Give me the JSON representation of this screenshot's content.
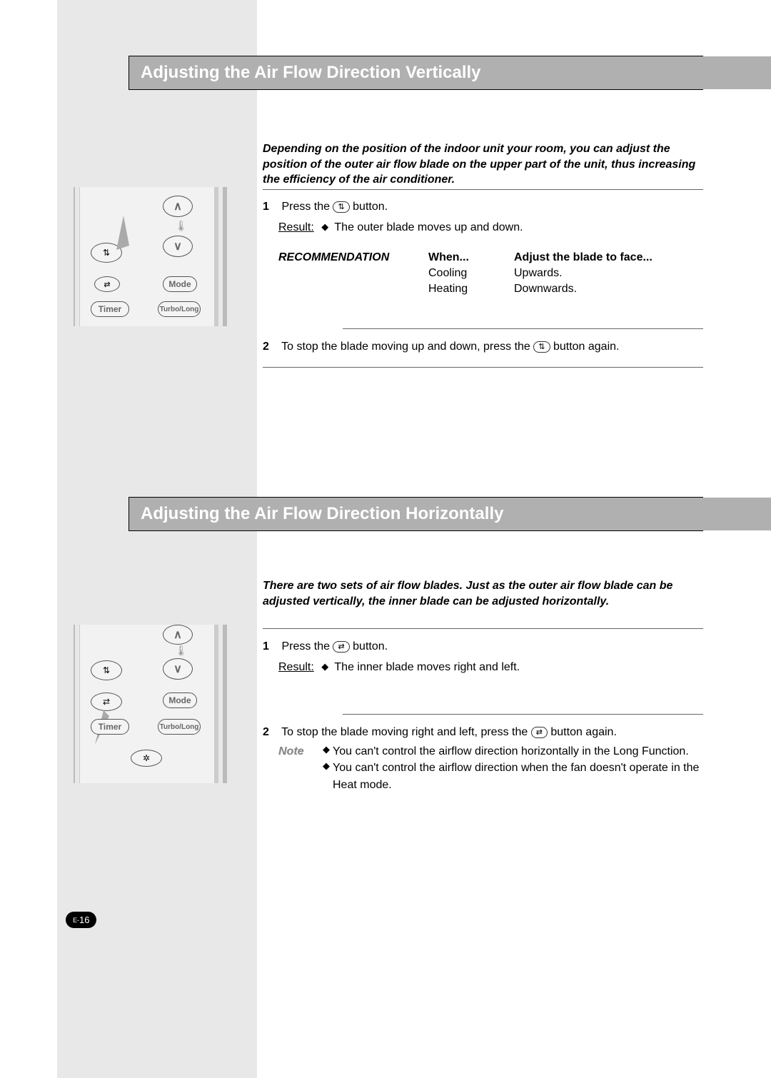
{
  "section1": {
    "title": "Adjusting the Air Flow Direction Vertically",
    "intro": "Depending on the position of the indoor unit your room, you can adjust the position of the outer air flow blade on the upper part of the unit, thus increasing the efficiency of the air conditioner.",
    "step1": {
      "num": "1",
      "press_before": "Press the ",
      "press_after": " button.",
      "result_label": "Result:",
      "result_text": "The outer blade moves up and down."
    },
    "recommendation": {
      "label": "RECOMMENDATION",
      "head_when": "When...",
      "head_adjust": "Adjust the blade to face...",
      "rows": [
        {
          "when": "Cooling",
          "adjust": "Upwards."
        },
        {
          "when": "Heating",
          "adjust": "Downwards."
        }
      ]
    },
    "step2": {
      "num": "2",
      "text_before": "To stop the blade moving up and down, press the ",
      "text_after": " button again."
    }
  },
  "section2": {
    "title": "Adjusting the Air Flow Direction Horizontally",
    "intro": "There are two sets of air flow blades. Just as the outer air flow blade can be adjusted vertically, the inner blade can be adjusted horizontally.",
    "step1": {
      "num": "1",
      "press_before": "Press the ",
      "press_after": " button.",
      "result_label": "Result:",
      "result_text": "The inner blade moves right and left."
    },
    "step2": {
      "num": "2",
      "text_before": "To stop the blade moving right and left, press the ",
      "text_after": " button again."
    },
    "note": {
      "label": "Note",
      "items": [
        "You can't control the airflow direction horizontally in the Long Function.",
        "You can't control the airflow direction when the fan doesn't operate in the Heat mode."
      ]
    }
  },
  "remote": {
    "mode": "Mode",
    "timer": "Timer",
    "turbolong": "Turbo/Long",
    "swing_vert_icon": "swing-vertical-icon",
    "swing_horiz_icon": "swing-horizontal-icon",
    "fan_icon": "fan-icon"
  },
  "page_number_prefix": "E-",
  "page_number": "16"
}
